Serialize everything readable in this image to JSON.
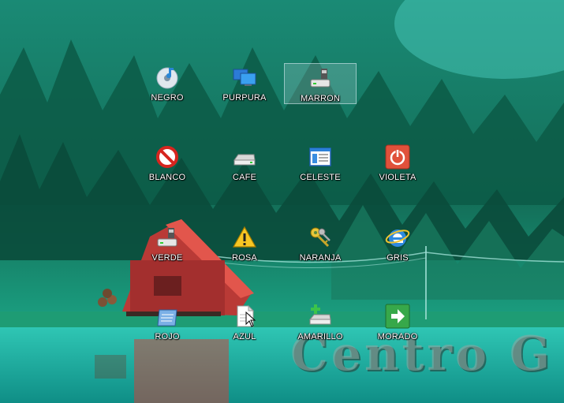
{
  "desktop": {
    "watermark_text": "Centro G",
    "icons": [
      {
        "label": "NEGRO",
        "icon": "media-disc-icon"
      },
      {
        "label": "PURPURA",
        "icon": "network-monitors-icon"
      },
      {
        "label": "MARRON",
        "icon": "usb-drive-icon",
        "selected": true
      },
      {
        "label": "BLANCO",
        "icon": "no-entry-icon"
      },
      {
        "label": "CAFE",
        "icon": "drive-icon"
      },
      {
        "label": "CELESTE",
        "icon": "window-list-icon"
      },
      {
        "label": "VIOLETA",
        "icon": "power-icon"
      },
      {
        "label": "VERDE",
        "icon": "usb-drive-icon"
      },
      {
        "label": "ROSA",
        "icon": "warning-icon"
      },
      {
        "label": "NARANJA",
        "icon": "keys-icon"
      },
      {
        "label": "GRIS",
        "icon": "internet-explorer-icon"
      },
      {
        "label": "ROJO",
        "icon": "clipboard-icon"
      },
      {
        "label": "AZUL",
        "icon": "document-icon"
      },
      {
        "label": "AMARILLO",
        "icon": "add-drive-icon"
      },
      {
        "label": "MORADO",
        "icon": "arrow-right-icon"
      }
    ]
  }
}
